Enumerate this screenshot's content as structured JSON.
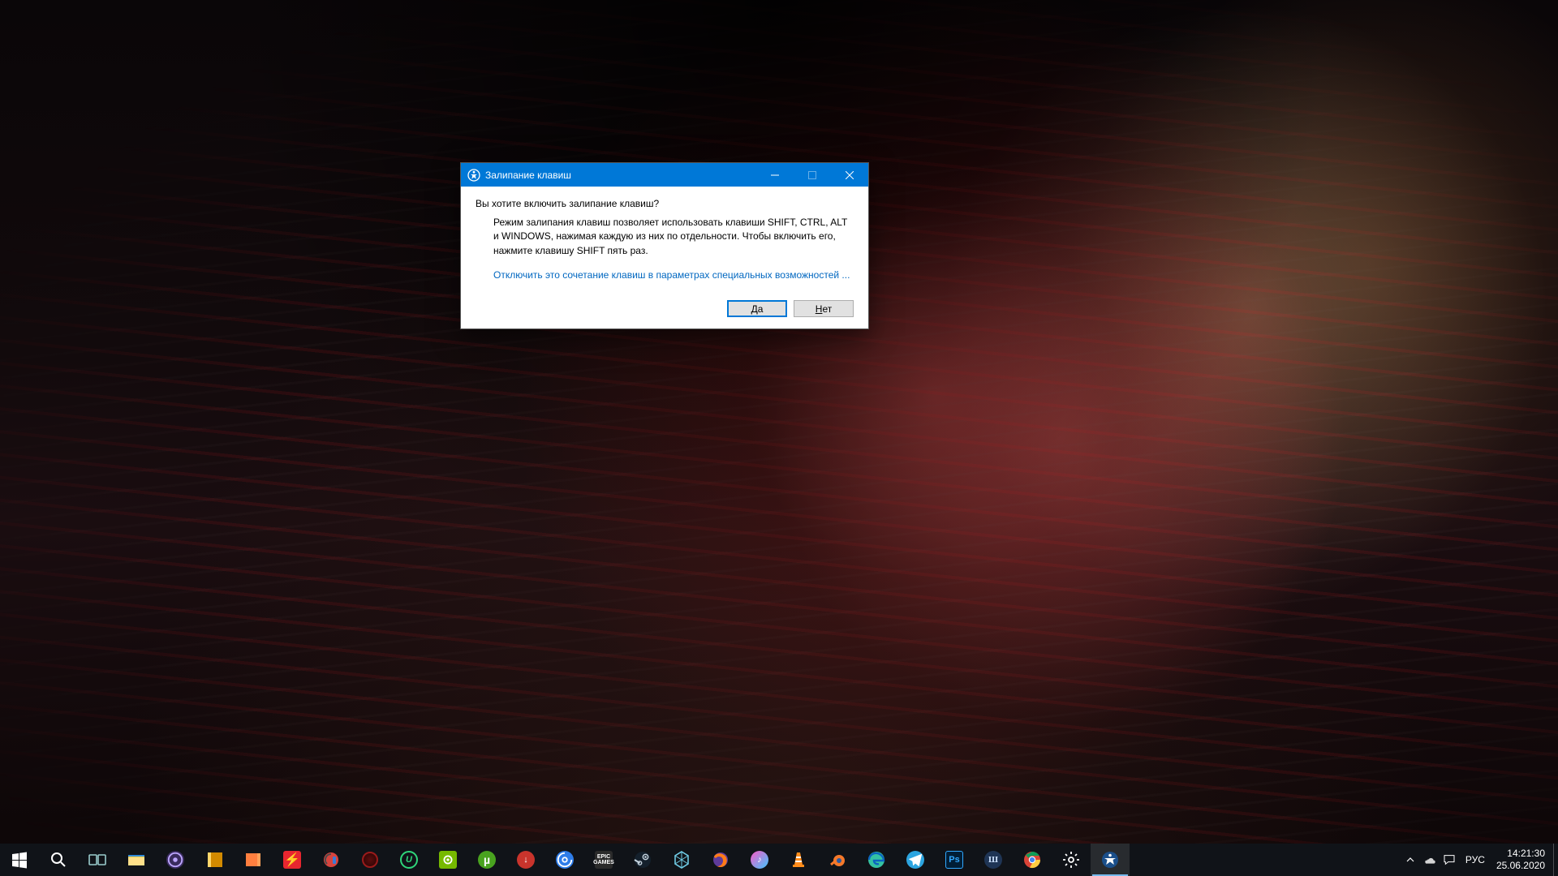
{
  "dialog": {
    "title": "Залипание клавиш",
    "question": "Вы хотите включить залипание клавиш?",
    "description": "Режим залипания клавиш позволяет использовать клавиши SHIFT, CTRL, ALT и WINDOWS, нажимая каждую из них по отдельности. Чтобы включить его, нажмите клавишу SHIFT пять раз.",
    "link_text": "Отключить это сочетание клавиш в параметрах специальных возможностей ...",
    "yes_prefix": "Д",
    "yes_suffix": "а",
    "no_prefix": "Н",
    "no_suffix": "ет"
  },
  "taskbar": {
    "items": [
      {
        "name": "start-button",
        "glyph": "win"
      },
      {
        "name": "search-button",
        "glyph": "search"
      },
      {
        "name": "task-view-button",
        "glyph": "taskview"
      },
      {
        "name": "file-explorer",
        "glyph": "explorer"
      },
      {
        "name": "obs-app",
        "glyph": "obs"
      },
      {
        "name": "notes-app",
        "glyph": "notes"
      },
      {
        "name": "onenote-app",
        "glyph": "onenote"
      },
      {
        "name": "antivirus-app",
        "glyph": "bolt"
      },
      {
        "name": "ccleaner-app",
        "glyph": "ccleaner"
      },
      {
        "name": "game-client-app",
        "glyph": "circle-red"
      },
      {
        "name": "uplay-refresh-app",
        "glyph": "uplay-green"
      },
      {
        "name": "nvidia-app",
        "glyph": "nvidia"
      },
      {
        "name": "utorrent-app",
        "glyph": "utorrent"
      },
      {
        "name": "downloader-app",
        "glyph": "download"
      },
      {
        "name": "ubisoft-app",
        "glyph": "ubisoft"
      },
      {
        "name": "epic-games-app",
        "glyph": "epic"
      },
      {
        "name": "steam-app",
        "glyph": "steam"
      },
      {
        "name": "unity-app",
        "glyph": "unity"
      },
      {
        "name": "firefox-app",
        "glyph": "firefox"
      },
      {
        "name": "itunes-app",
        "glyph": "itunes"
      },
      {
        "name": "vlc-app",
        "glyph": "vlc"
      },
      {
        "name": "blender-app",
        "glyph": "blender"
      },
      {
        "name": "edge-app",
        "glyph": "edge"
      },
      {
        "name": "telegram-app",
        "glyph": "telegram"
      },
      {
        "name": "photoshop-app",
        "glyph": "ps"
      },
      {
        "name": "word-processor-app",
        "glyph": "w-circle"
      },
      {
        "name": "chrome-app",
        "glyph": "chrome"
      },
      {
        "name": "settings-app",
        "glyph": "gear"
      },
      {
        "name": "accessibility-app",
        "glyph": "ease",
        "active": true
      }
    ]
  },
  "systray": {
    "language": "РУС",
    "time": "14:21:30",
    "date": "25.06.2020"
  }
}
